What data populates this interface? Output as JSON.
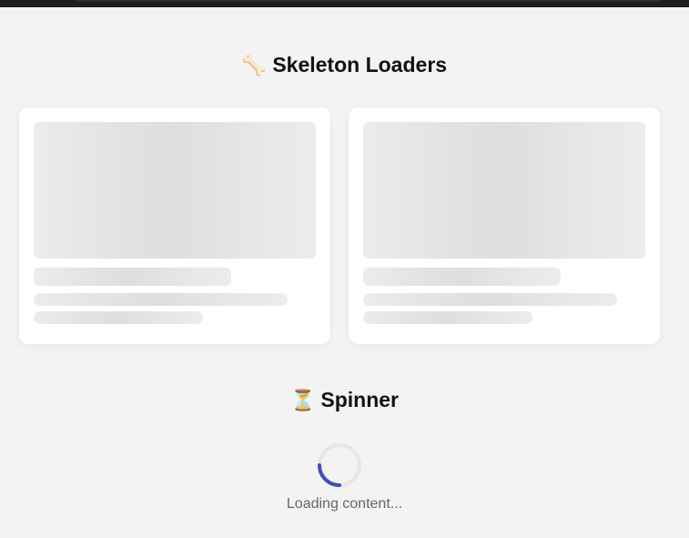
{
  "sections": {
    "skeleton": {
      "icon": "bone-icon",
      "emoji": "🦴",
      "title": "Skeleton Loaders"
    },
    "spinner": {
      "icon": "hourglass-icon",
      "emoji": "⏳",
      "title": "Spinner",
      "loading_text": "Loading content...",
      "accent_color": "#3f51b5",
      "track_color": "#e6e6e6"
    }
  },
  "skeleton_cards": 2,
  "colors": {
    "page_background": "#f3f3f3",
    "card_background": "#ffffff",
    "skeleton_base": "#e6e6e6"
  }
}
